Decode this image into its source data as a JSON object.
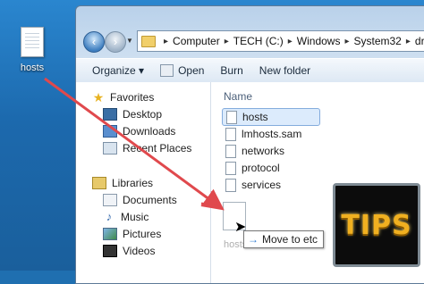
{
  "desktop": {
    "file_icon": {
      "label": "hosts",
      "icon": "text-file-icon"
    }
  },
  "window": {
    "address": {
      "crumbs": [
        "Computer",
        "TECH (C:)",
        "Windows",
        "System32",
        "driv"
      ]
    },
    "toolbar": {
      "organize": "Organize ▾",
      "open": "Open",
      "burn": "Burn",
      "new_folder": "New folder"
    },
    "nav": {
      "favorites": "Favorites",
      "desktop": "Desktop",
      "downloads": "Downloads",
      "recent": "Recent Places",
      "libraries": "Libraries",
      "documents": "Documents",
      "music": "Music",
      "pictures": "Pictures",
      "videos": "Videos"
    },
    "content": {
      "column_name": "Name",
      "files": [
        "hosts",
        "lmhosts.sam",
        "networks",
        "protocol",
        "services"
      ],
      "selected_index": 0
    }
  },
  "drag": {
    "ghost_label": "hosts",
    "tooltip": "Move to etc"
  },
  "badge": {
    "text": "TIPS"
  },
  "colors": {
    "arrow": "#e0494d",
    "accent": "#2e7bd1"
  }
}
